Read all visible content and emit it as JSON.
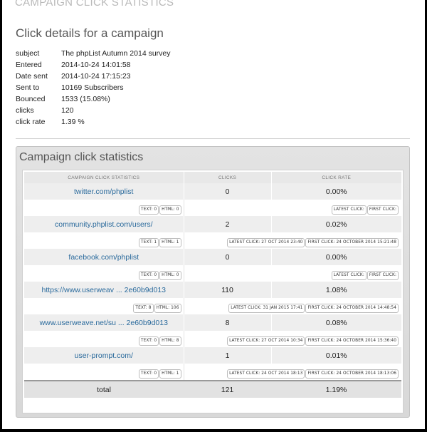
{
  "page": {
    "header": "CAMPAIGN CLICK STATISTICS",
    "details_title": "Click details for a campaign"
  },
  "details": [
    {
      "key": "subject",
      "value": "The phpList Autumn 2014 survey"
    },
    {
      "key": "Entered",
      "value": "2014-10-24 14:01:58"
    },
    {
      "key": "Date sent",
      "value": "2014-10-24 17:15:23"
    },
    {
      "key": "Sent to",
      "value": "10169 Subscribers"
    },
    {
      "key": "Bounced",
      "value": "1533 (15.08%)"
    },
    {
      "key": "clicks",
      "value": "120"
    },
    {
      "key": "click rate",
      "value": "1.39 %"
    }
  ],
  "panel": {
    "title": "Campaign click statistics",
    "columns": [
      "CAMPAIGN CLICK STATISTICS",
      "CLICKS",
      "CLICK RATE"
    ]
  },
  "rows": [
    {
      "url": "twitter.com/phplist",
      "clicks": "0",
      "rate": "0.00%",
      "text": "TEXT: 0",
      "html": "HTML: 0",
      "latest": "LATEST CLICK:",
      "first": "FIRST CLICK:"
    },
    {
      "url": "community.phplist.com/users/",
      "clicks": "2",
      "rate": "0.02%",
      "text": "TEXT: 1",
      "html": "HTML: 1",
      "latest": "LATEST CLICK: 27 OCT 2014 23:40",
      "first": "FIRST CLICK: 24 OCTOBER 2014 15:21:48"
    },
    {
      "url": "facebook.com/phplist",
      "clicks": "0",
      "rate": "0.00%",
      "text": "TEXT: 0",
      "html": "HTML: 0",
      "latest": "LATEST CLICK:",
      "first": "FIRST CLICK:"
    },
    {
      "url": "https://www.userweav ... 2e60b9d013",
      "clicks": "110",
      "rate": "1.08%",
      "text": "TEXT: 8",
      "html": "HTML: 106",
      "latest": "LATEST CLICK: 31 JAN 2015 17:41",
      "first": "FIRST CLICK: 24 OCTOBER 2014 14:48:54"
    },
    {
      "url": "www.userweave.net/su ... 2e60b9d013",
      "clicks": "8",
      "rate": "0.08%",
      "text": "TEXT: 0",
      "html": "HTML: 8",
      "latest": "LATEST CLICK: 27 OCT 2014 10:34",
      "first": "FIRST CLICK: 24 OCTOBER 2014 15:36:40"
    },
    {
      "url": "user-prompt.com/",
      "clicks": "1",
      "rate": "0.01%",
      "text": "TEXT: 0",
      "html": "HTML: 1",
      "latest": "LATEST CLICK: 24 OCT 2014 18:13",
      "first": "FIRST CLICK: 24 OCTOBER 2014 18:13:06"
    }
  ],
  "total": {
    "label": "total",
    "clicks": "121",
    "rate": "1.19%"
  }
}
